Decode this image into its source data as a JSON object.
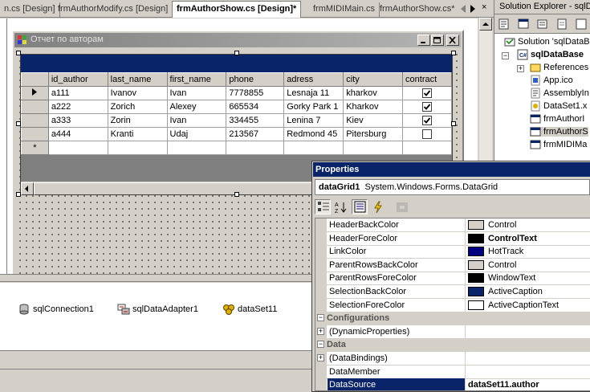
{
  "doc_tabs": [
    {
      "label": "n.cs [Design]",
      "active": false
    },
    {
      "label": "frmAuthorModify.cs [Design]",
      "active": false
    },
    {
      "label": "frmAuthorShow.cs [Design]*",
      "active": true
    },
    {
      "label": "frmMIDIMain.cs",
      "active": false
    },
    {
      "label": "frmAuthorShow.cs*",
      "active": false
    }
  ],
  "doc_tabs_close": "×",
  "form": {
    "title": "Отчет по авторам"
  },
  "grid": {
    "columns": [
      "id_author",
      "last_name",
      "first_name",
      "phone",
      "adress",
      "city",
      "contract"
    ],
    "rows": [
      {
        "id_author": "a111",
        "last_name": "Ivanov",
        "first_name": "Ivan",
        "phone": "7778855",
        "adress": "Lesnaja 11",
        "city": "kharkov",
        "contract": true
      },
      {
        "id_author": "a222",
        "last_name": "Zorich",
        "first_name": "Alexey",
        "phone": "665534",
        "adress": "Gorky Park 1",
        "city": "Kharkov",
        "contract": true
      },
      {
        "id_author": "a333",
        "last_name": "Zorin",
        "first_name": "Ivan",
        "phone": "334455",
        "adress": "Lenina 7",
        "city": "Kiev",
        "contract": true
      },
      {
        "id_author": "a444",
        "last_name": "Kranti",
        "first_name": "Udaj",
        "phone": "213567",
        "adress": "Redmond 45",
        "city": "Pitersburg",
        "contract": false
      }
    ],
    "new_row_marker": "*"
  },
  "tray": {
    "items": [
      {
        "label": "sqlConnection1",
        "icon": "sql-connection-icon"
      },
      {
        "label": "sqlDataAdapter1",
        "icon": "sql-data-adapter-icon"
      },
      {
        "label": "dataSet11",
        "icon": "dataset-icon"
      }
    ]
  },
  "solution_explorer": {
    "title": "Solution Explorer - sqlDa",
    "nodes": [
      {
        "label": "Solution 'sqlDataBa",
        "icon": "solution-icon",
        "bold": false
      },
      {
        "label": "sqlDataBase",
        "icon": "project-icon",
        "bold": true
      },
      {
        "label": "References",
        "icon": "references-icon",
        "bold": false
      },
      {
        "label": "App.ico",
        "icon": "ico-file-icon",
        "bold": false
      },
      {
        "label": "AssemblyIn",
        "icon": "cs-file-icon",
        "bold": false
      },
      {
        "label": "DataSet1.x",
        "icon": "dataset-file-icon",
        "bold": false
      },
      {
        "label": "frmAuthorI",
        "icon": "form-file-icon",
        "bold": false
      },
      {
        "label": "frmAuthorS",
        "icon": "form-file-icon",
        "bold": false
      },
      {
        "label": "frmMIDIMa",
        "icon": "form-file-icon",
        "bold": false
      }
    ]
  },
  "properties": {
    "title": "Properties",
    "object_name": "dataGrid1",
    "object_type": "System.Windows.Forms.DataGrid",
    "rows": [
      {
        "kind": "prop",
        "name": "HeaderBackColor",
        "value": "Control",
        "swatch": "#d4d0c8",
        "bold": false
      },
      {
        "kind": "prop",
        "name": "HeaderForeColor",
        "value": "ControlText",
        "swatch": "#000000",
        "bold": true
      },
      {
        "kind": "prop",
        "name": "LinkColor",
        "value": "HotTrack",
        "swatch": "#000080",
        "bold": false
      },
      {
        "kind": "prop",
        "name": "ParentRowsBackColor",
        "value": "Control",
        "swatch": "#d4d0c8",
        "bold": false
      },
      {
        "kind": "prop",
        "name": "ParentRowsForeColor",
        "value": "WindowText",
        "swatch": "#000000",
        "bold": false
      },
      {
        "kind": "prop",
        "name": "SelectionBackColor",
        "value": "ActiveCaption",
        "swatch": "#0a246a",
        "bold": false
      },
      {
        "kind": "prop",
        "name": "SelectionForeColor",
        "value": "ActiveCaptionText",
        "swatch": "#ffffff",
        "bold": false
      },
      {
        "kind": "cat",
        "name": "Configurations"
      },
      {
        "kind": "prop",
        "name": "(DynamicProperties)",
        "value": "",
        "expand": true
      },
      {
        "kind": "cat",
        "name": "Data"
      },
      {
        "kind": "prop",
        "name": "(DataBindings)",
        "value": "",
        "expand": true
      },
      {
        "kind": "prop",
        "name": "DataMember",
        "value": ""
      },
      {
        "kind": "prop",
        "name": "DataSource",
        "value": "dataSet11.author",
        "bold": true,
        "selected": true
      }
    ]
  },
  "colors": {
    "caption_active": "#0a246a",
    "face": "#d4d0c8",
    "shadow": "#808080"
  }
}
